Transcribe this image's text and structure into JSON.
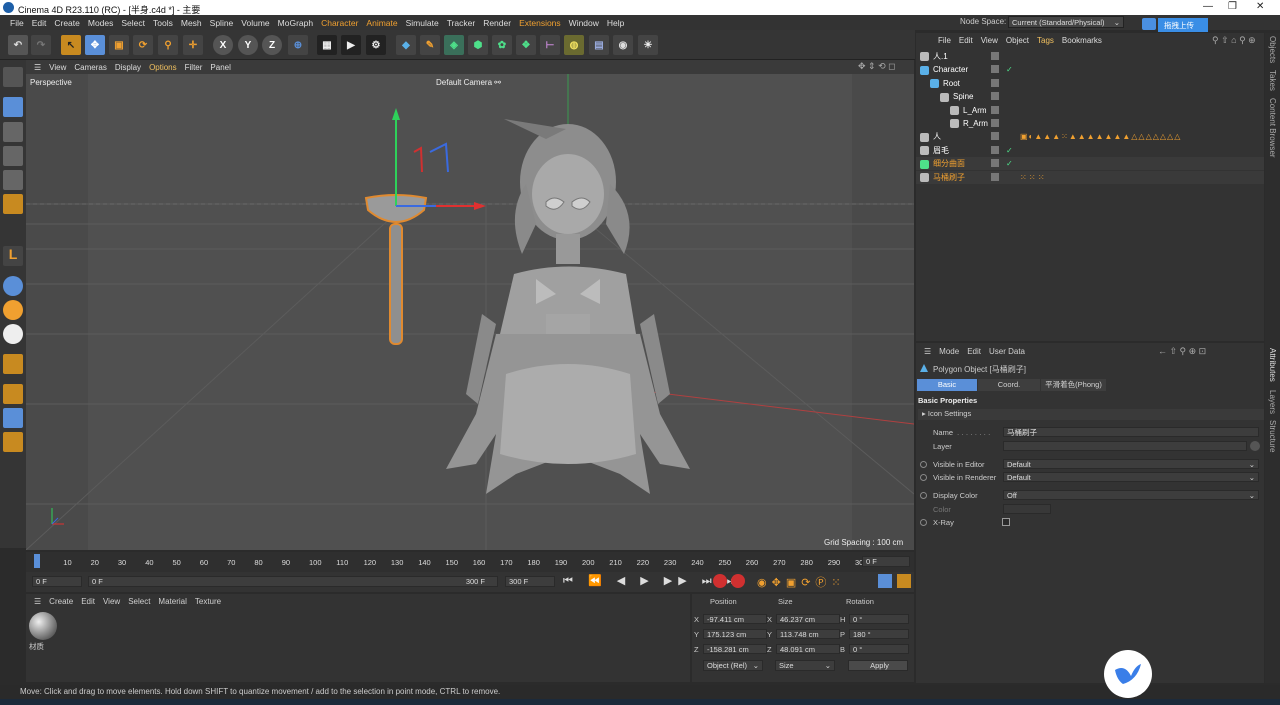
{
  "window": {
    "title": "Cinema 4D R23.110 (RC) - [半身.c4d *] - 主要"
  },
  "menu": [
    "File",
    "Edit",
    "Create",
    "Modes",
    "Select",
    "Tools",
    "Mesh",
    "Spline",
    "Volume",
    "MoGraph",
    "Character",
    "Animate",
    "Simulate",
    "Tracker",
    "Render",
    "Extensions",
    "Window",
    "Help"
  ],
  "nodespace": {
    "label": "Node Space:",
    "value": "Current (Standard/Physical)"
  },
  "upload_button": "拖拽上传",
  "viewport": {
    "menu": [
      "View",
      "Cameras",
      "Display",
      "Options",
      "Filter",
      "Panel"
    ],
    "projection": "Perspective",
    "camera": "Default Camera",
    "grid_spacing": "Grid Spacing : 100 cm"
  },
  "timeline": {
    "ticks": [
      "0",
      "10",
      "20",
      "30",
      "40",
      "50",
      "60",
      "70",
      "80",
      "90",
      "100",
      "110",
      "120",
      "130",
      "140",
      "150",
      "160",
      "170",
      "180",
      "190",
      "200",
      "210",
      "220",
      "230",
      "240",
      "250",
      "260",
      "270",
      "280",
      "290",
      "300"
    ],
    "current_frame": "0 F",
    "start": "0 F",
    "min": "0 F",
    "max": "300 F",
    "end": "300 F"
  },
  "material_manager": {
    "menu": [
      "Create",
      "Edit",
      "View",
      "Select",
      "Material",
      "Texture"
    ],
    "materials": [
      {
        "name": "材质"
      }
    ]
  },
  "coordinates": {
    "headers": [
      "Position",
      "Size",
      "Rotation"
    ],
    "rows": [
      {
        "axis": "X",
        "pos": "-97.411 cm",
        "size_axis": "X",
        "size": "46.237 cm",
        "rot_axis": "H",
        "rot": "0 °"
      },
      {
        "axis": "Y",
        "pos": "175.123 cm",
        "size_axis": "Y",
        "size": "113.748 cm",
        "rot_axis": "P",
        "rot": "180 °"
      },
      {
        "axis": "Z",
        "pos": "-158.281 cm",
        "size_axis": "Z",
        "size": "48.091 cm",
        "rot_axis": "B",
        "rot": "0 °"
      }
    ],
    "mode": "Object (Rel)",
    "size_mode": "Size",
    "apply": "Apply"
  },
  "object_manager": {
    "menu": [
      "File",
      "Edit",
      "View",
      "Object",
      "Tags",
      "Bookmarks"
    ],
    "objects": [
      {
        "name": "人.1",
        "color": "#ffffff"
      },
      {
        "name": "Character",
        "color": "#ffffff"
      },
      {
        "name": "Root",
        "color": "#ffffff"
      },
      {
        "name": "Spine",
        "color": "#ffffff"
      },
      {
        "name": "L_Arm",
        "color": "#ffffff"
      },
      {
        "name": "R_Arm",
        "color": "#ffffff"
      },
      {
        "name": "人",
        "color": "#ffffff"
      },
      {
        "name": "眉毛",
        "color": "#ffffff"
      },
      {
        "name": "细分曲面",
        "color": "#f0a030"
      },
      {
        "name": "马桶刷子",
        "color": "#f0a030"
      }
    ]
  },
  "attributes": {
    "menu": [
      "Mode",
      "Edit",
      "User Data"
    ],
    "object_title": "Polygon Object [马桶刷子]",
    "tabs": [
      "Basic",
      "Coord.",
      "平滑着色(Phong)"
    ],
    "section": "Basic Properties",
    "icon_settings": "Icon Settings",
    "fields": {
      "name_label": "Name",
      "name_value": "马桶刷子",
      "layer_label": "Layer",
      "vis_editor_label": "Visible in Editor",
      "vis_editor_value": "Default",
      "vis_render_label": "Visible in Renderer",
      "vis_render_value": "Default",
      "display_color_label": "Display Color",
      "display_color_value": "Off",
      "color_label": "Color",
      "xray_label": "X-Ray"
    }
  },
  "right_tabs": [
    "Objects",
    "Takes",
    "Content Browser",
    "Attributes",
    "Layers",
    "Structure"
  ],
  "status": "Move: Click and drag to move elements. Hold down SHIFT to quantize movement / add to the selection in point mode, CTRL to remove.",
  "colors": {
    "accent": "#f0a030",
    "selection": "#5a8fd8",
    "viewport_bg": "#4a4a4a"
  }
}
